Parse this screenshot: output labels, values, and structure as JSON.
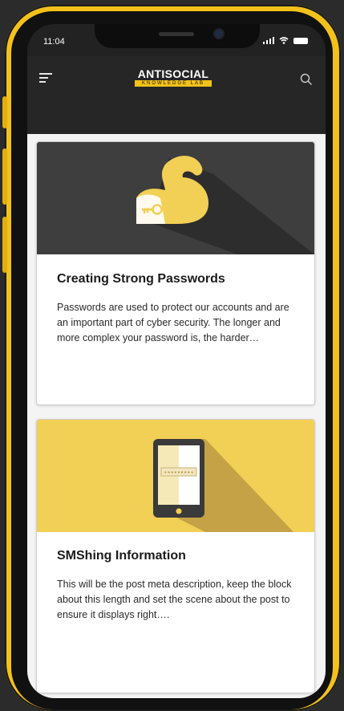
{
  "status": {
    "time": "11:04"
  },
  "header": {
    "logo_main": "ANTISOCIAL",
    "logo_sub": "KNOWLEDGE LAB"
  },
  "posts": [
    {
      "title": "Creating Strong Passwords",
      "description": "Passwords are used to protect our accounts and are an important part of cyber security. The longer and more complex your password is, the harder…",
      "hero_icon": "flexed-arm-key-icon"
    },
    {
      "title": "SMShing Information",
      "description": "This will be the post meta description, keep the block about this length and set the scene about the post to ensure it displays right….",
      "hero_icon": "smartphone-password-icon"
    }
  ],
  "colors": {
    "accent": "#f3c21a",
    "header_bg": "#262626",
    "card1_hero_bg": "#3e3e3e",
    "card2_hero_bg": "#f2cf55"
  }
}
